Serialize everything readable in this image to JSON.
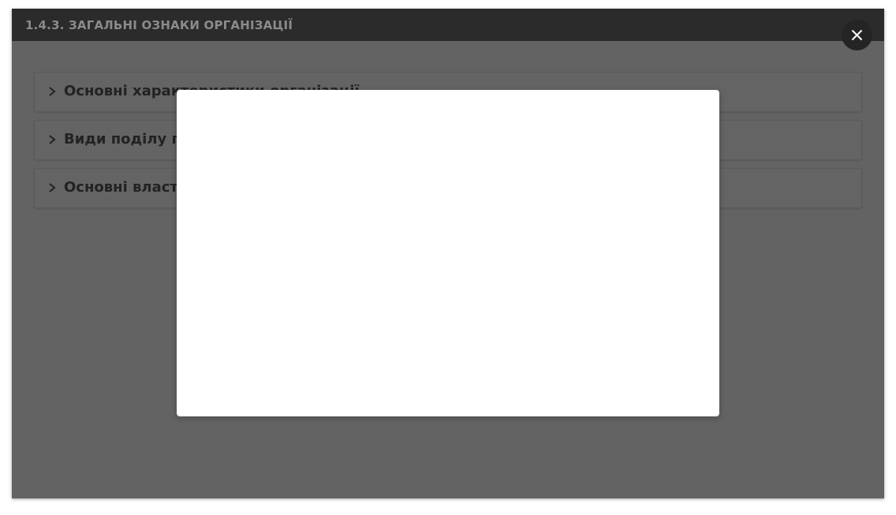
{
  "window": {
    "title": "1.4.3. ЗАГАЛЬНІ ОЗНАКИ ОРГАНІЗАЦІЇ"
  },
  "accordion": {
    "items": [
      {
        "label": "Основні характеристики організації",
        "icon": "chevron-right-icon"
      },
      {
        "label": "Види поділу праці",
        "icon": "chevron-right-icon"
      },
      {
        "label": "Основні властивості організації",
        "icon": "chevron-right-icon"
      }
    ]
  },
  "close_button": {
    "icon": "close-icon"
  },
  "colors": {
    "overlay": "#636363",
    "titlebar": "#2b2b2b",
    "close_button": "#242424",
    "modal": "#ffffff"
  }
}
